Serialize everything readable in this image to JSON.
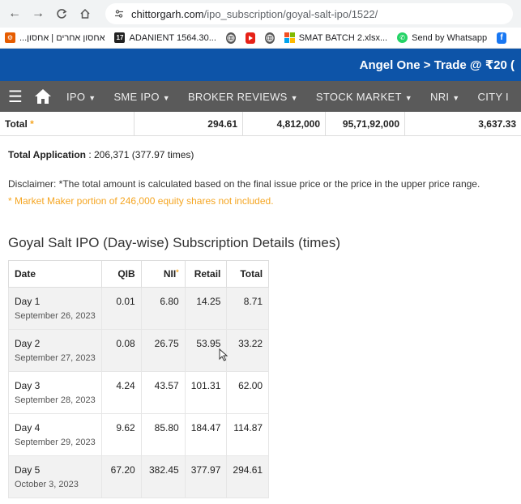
{
  "browser": {
    "url_domain": "chittorgarh.com",
    "url_path": "/ipo_subscription/goyal-salt-ipo/1522/"
  },
  "bookmarks": [
    {
      "label": "...אחסון אחרים | אחסון",
      "color": "#e65c00"
    },
    {
      "label": "ADANIENT 1564.30...",
      "color": "#333333"
    },
    {
      "label": "",
      "color": "#555555"
    },
    {
      "label": "",
      "color": "#e62117"
    },
    {
      "label": "",
      "color": "#555555"
    },
    {
      "label": "SMAT BATCH 2.xlsx...",
      "color": "#f25022"
    },
    {
      "label": "Send by Whatsapp",
      "color": "#25d366"
    }
  ],
  "banner": {
    "text": "Angel One > Trade @ ₹20 ("
  },
  "sitenav": {
    "items": [
      "IPO",
      "SME IPO",
      "BROKER REVIEWS",
      "STOCK MARKET",
      "NRI",
      "CITY I"
    ]
  },
  "total_row": {
    "label": "Total",
    "star": "*",
    "v1": "294.61",
    "v2": "4,812,000",
    "v3": "95,71,92,000",
    "v4": "3,637.33"
  },
  "total_application": {
    "label": "Total Application",
    "value": " : 206,371 (377.97 times)"
  },
  "disclaimer": "Disclaimer: *The total amount is calculated based on the final issue price or the price in the upper price range.",
  "note": "* Market Maker portion of 246,000 equity shares not included.",
  "section_title": "Goyal Salt IPO (Day-wise) Subscription Details (times)",
  "table": {
    "headers": [
      "Date",
      "QIB",
      "NII",
      "Retail",
      "Total"
    ],
    "nii_star": "*",
    "rows": [
      {
        "day": "Day 1",
        "date": "September 26, 2023",
        "qib": "0.01",
        "nii": "6.80",
        "retail": "14.25",
        "total": "8.71"
      },
      {
        "day": "Day 2",
        "date": "September 27, 2023",
        "qib": "0.08",
        "nii": "26.75",
        "retail": "53.95",
        "total": "33.22"
      },
      {
        "day": "Day 3",
        "date": "September 28, 2023",
        "qib": "4.24",
        "nii": "43.57",
        "retail": "101.31",
        "total": "62.00"
      },
      {
        "day": "Day 4",
        "date": "September 29, 2023",
        "qib": "9.62",
        "nii": "85.80",
        "retail": "184.47",
        "total": "114.87"
      },
      {
        "day": "Day 5",
        "date": "October 3, 2023",
        "qib": "67.20",
        "nii": "382.45",
        "retail": "377.97",
        "total": "294.61"
      }
    ]
  }
}
